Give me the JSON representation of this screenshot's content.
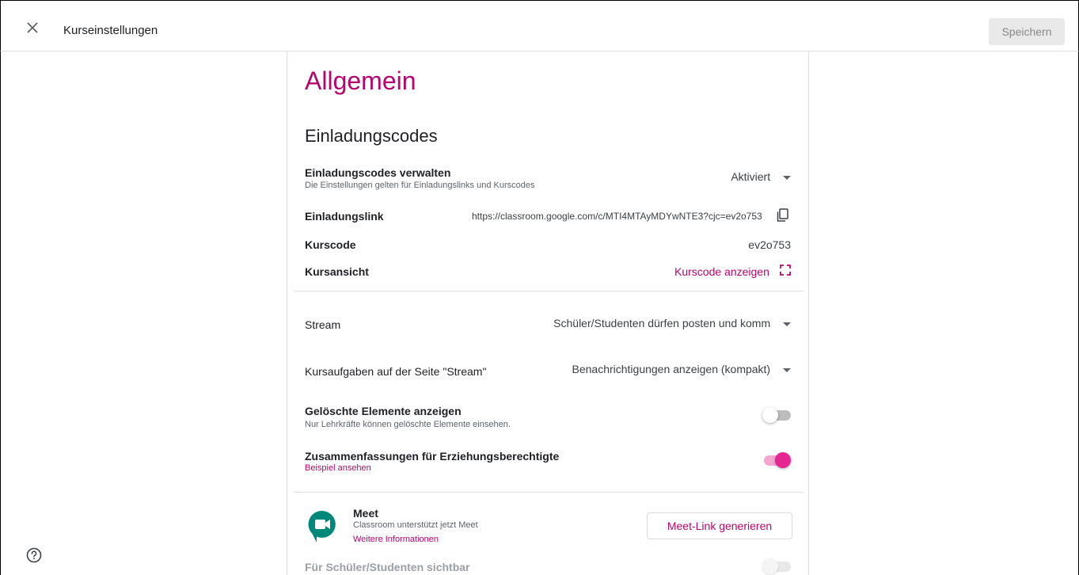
{
  "header": {
    "title": "Kurseinstellungen",
    "save_label": "Speichern"
  },
  "main": {
    "page_title": "Allgemein",
    "section_title": "Einladungscodes",
    "manage": {
      "label": "Einladungscodes verwalten",
      "sub": "Die Einstellungen gelten für Einladungslinks und Kurscodes",
      "value": "Aktiviert"
    },
    "invite_link": {
      "label": "Einladungslink",
      "value": "https://classroom.google.com/c/MTI4MTAyMDYwNTE3?cjc=ev2o753"
    },
    "course_code": {
      "label": "Kurscode",
      "value": "ev2o753"
    },
    "course_view": {
      "label": "Kursansicht",
      "action": "Kurscode anzeigen"
    },
    "stream": {
      "label": "Stream",
      "value": "Schüler/Studenten dürfen posten und komm"
    },
    "classwork": {
      "label": "Kursaufgaben auf der Seite \"Stream\"",
      "value": "Benachrichtigungen anzeigen (kompakt)"
    },
    "deleted": {
      "label": "Gelöschte Elemente anzeigen",
      "sub": "Nur Lehrkräfte können gelöschte Elemente einsehen.",
      "enabled": false
    },
    "guardian": {
      "label": "Zusammenfassungen für Erziehungsberechtigte",
      "link": "Beispiel ansehen",
      "enabled": true
    },
    "meet": {
      "title": "Meet",
      "sub": "Classroom unterstützt jetzt Meet",
      "link": "Weitere Informationen",
      "button": "Meet-Link generieren"
    },
    "visible": {
      "label": "Für Schüler/Studenten sichtbar",
      "enabled": false
    }
  },
  "icons": {
    "close": "close-icon",
    "help": "help-icon",
    "copy": "copy-icon",
    "fullscreen": "fullscreen-icon",
    "meet": "meet-icon"
  },
  "colors": {
    "accent": "#b8056e",
    "toggle_on": "#e52592",
    "meet_green": "#00897b"
  }
}
